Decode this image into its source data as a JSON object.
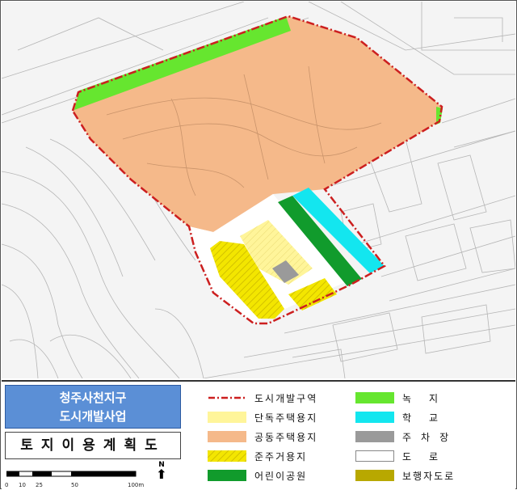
{
  "title": {
    "line1": "청주사천지구",
    "line2": "도시개발사업"
  },
  "plan_title": "토지이용계획도",
  "scale": {
    "labels": [
      "0",
      "10",
      "25",
      "50",
      "100m"
    ]
  },
  "north_label": "N",
  "legend": [
    {
      "key": "boundary",
      "label": "도시개발구역",
      "color": "#cc1f1f"
    },
    {
      "key": "single_housing",
      "label": "단독주택용지",
      "color": "#fff59a"
    },
    {
      "key": "apartment",
      "label": "공동주택용지",
      "color": "#f5b98a"
    },
    {
      "key": "semi_residential",
      "label": "준주거용지",
      "color": "#f3e600"
    },
    {
      "key": "children_park",
      "label": "어린이공원",
      "color": "#119b2c"
    },
    {
      "key": "green",
      "label": "녹지",
      "color": "#66e62f"
    },
    {
      "key": "school",
      "label": "학교",
      "color": "#13e6ef"
    },
    {
      "key": "parking",
      "label": "주차장",
      "color": "#9a9a9a"
    },
    {
      "key": "road",
      "label": "도로",
      "color": "#ffffff"
    },
    {
      "key": "pedestrian",
      "label": "보행자도로",
      "color": "#b8a800"
    }
  ]
}
